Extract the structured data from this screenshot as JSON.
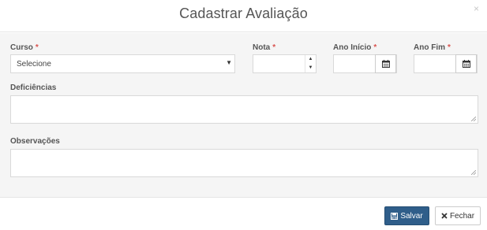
{
  "modal": {
    "title": "Cadastrar Avaliação",
    "close_glyph": "×"
  },
  "form": {
    "curso": {
      "label": "Curso",
      "required_mark": "*",
      "selected": "Selecione"
    },
    "nota": {
      "label": "Nota",
      "required_mark": "*",
      "value": ""
    },
    "ano_inicio": {
      "label": "Ano Início",
      "required_mark": "*",
      "value": ""
    },
    "ano_fim": {
      "label": "Ano Fim",
      "required_mark": "*",
      "value": ""
    },
    "deficiencias": {
      "label": "Deficiências",
      "value": ""
    },
    "observacoes": {
      "label": "Observações",
      "value": ""
    }
  },
  "footer": {
    "save_label": "Salvar",
    "close_label": "Fechar"
  },
  "colors": {
    "required": "#d9534f",
    "primary_button": "#2f5e8a",
    "body_background": "#f5f5f5"
  },
  "icons": {
    "save": "floppy-disk-icon",
    "close": "times-icon",
    "calendar": "calendar-icon",
    "dropdown": "caret-down-icon"
  }
}
